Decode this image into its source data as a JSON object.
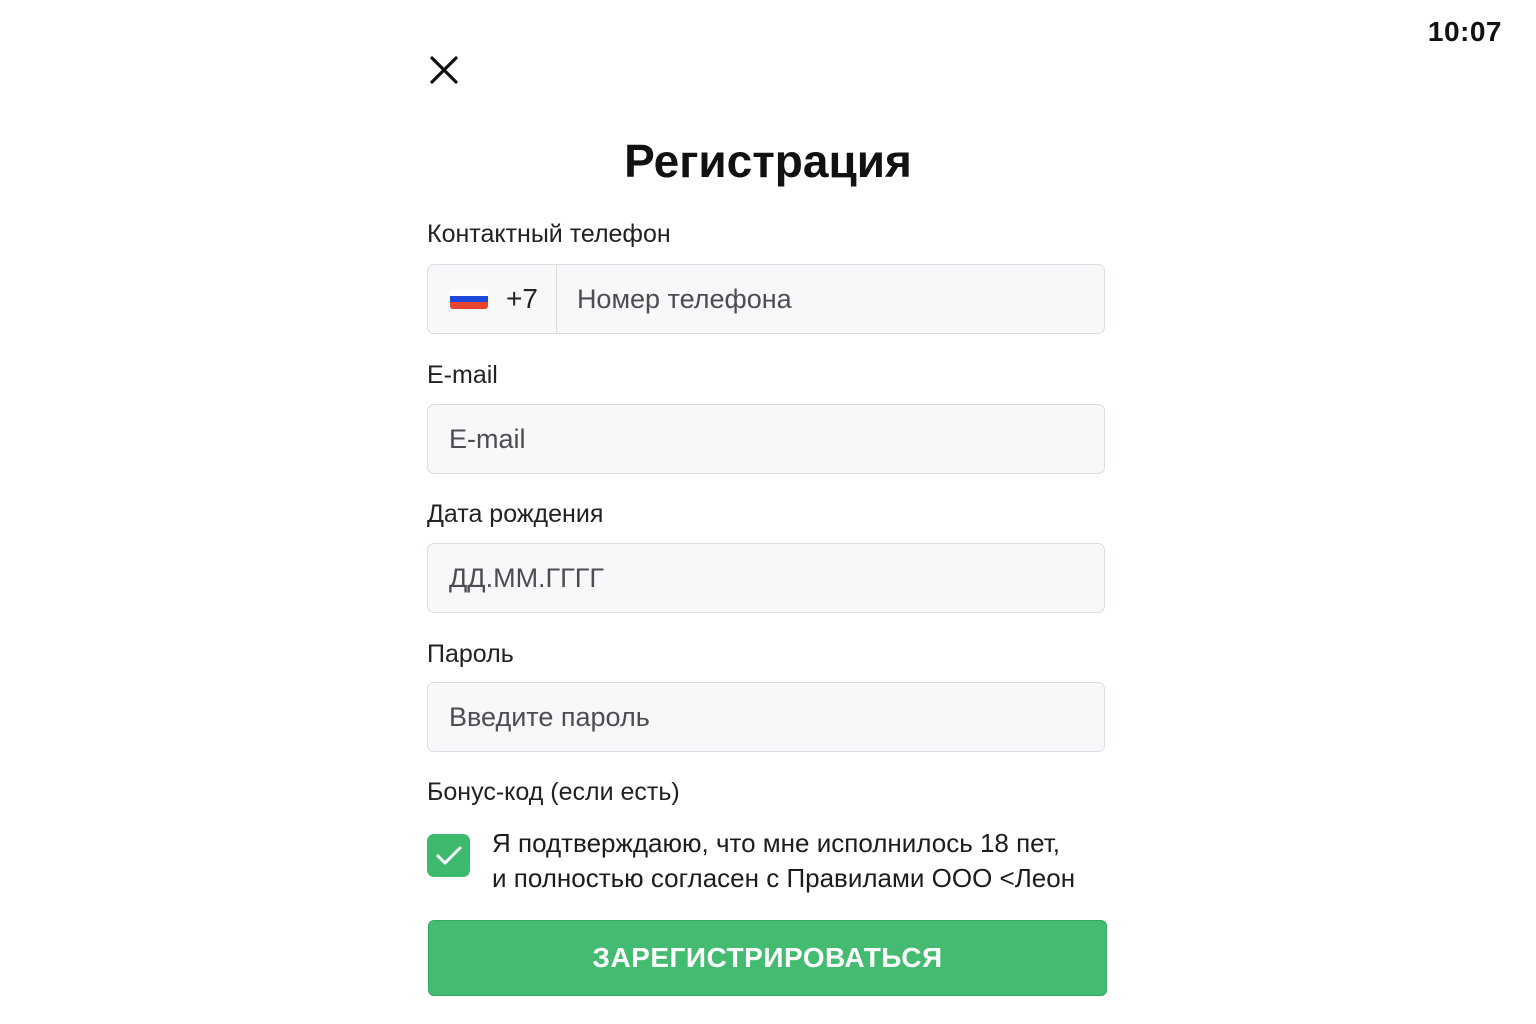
{
  "status_bar": {
    "time": "10:07"
  },
  "header": {
    "title": "Регистрация"
  },
  "form": {
    "phone": {
      "label": "Контактный телефон",
      "dial_code": "+7",
      "placeholder": "Номер телефона",
      "value": "",
      "flag_colors": [
        "#ffffff",
        "#1f49d8",
        "#e8432c"
      ]
    },
    "email": {
      "label": "E-mail",
      "placeholder": "E-mail",
      "value": ""
    },
    "birthdate": {
      "label": "Дата рождения",
      "placeholder": "ДД.ММ.ГГГГ",
      "value": ""
    },
    "password": {
      "label": "Пароль",
      "placeholder": "Введите пароль",
      "value": ""
    },
    "bonus": {
      "label": "Бонус-код (если есть)"
    },
    "consent": {
      "checked": true,
      "line1": "Я подтверждаюю, что мне исполнилось 18 пет,",
      "line2": "и полностью согласен с Правилами ООО <Леон"
    },
    "submit_label": "ЗАРЕГИСТРИРОВАТЬСЯ"
  },
  "colors": {
    "accent": "#43bc72",
    "checkbox": "#3dba6e",
    "input_bg": "#f7f8fa",
    "input_border": "#d9dce1"
  },
  "icons": {
    "close": "close-icon",
    "checkmark": "checkmark-icon",
    "flag": "russia-flag-icon"
  }
}
